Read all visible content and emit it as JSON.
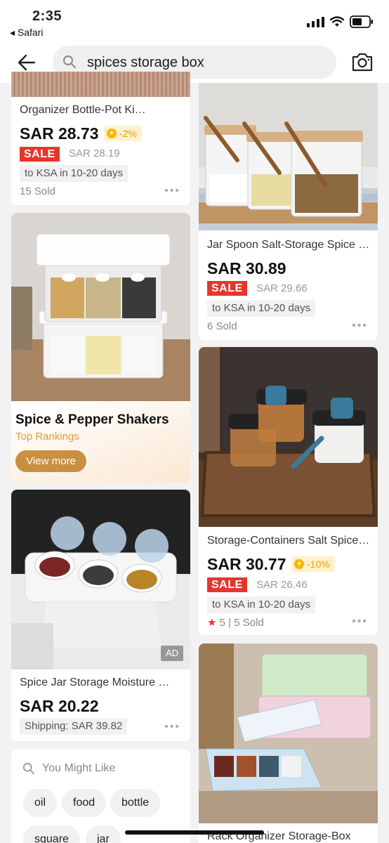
{
  "status_bar": {
    "time": "2:35",
    "back_app": "◂ Safari"
  },
  "search": {
    "query": "spices storage box"
  },
  "left_column": {
    "card1": {
      "title": "Organizer Bottle-Pot Kitchen",
      "price": "SAR 28.73",
      "discount": "-2%",
      "sale_label": "SALE",
      "old_price": "SAR 28.19",
      "shipping": "to KSA in 10-20 days",
      "sold": "15 Sold"
    },
    "promo": {
      "title": "Spice & Pepper Shakers",
      "subtitle": "Top Rankings",
      "button": "View more"
    },
    "card3": {
      "title": "Spice Jar Storage Moisture Proof",
      "price": "SAR 20.22",
      "shipping": "Shipping: SAR 39.82",
      "ad": "AD"
    },
    "might_like": {
      "title": "You Might Like",
      "chips": [
        "oil",
        "food",
        "bottle",
        "square",
        "jar"
      ]
    }
  },
  "right_column": {
    "card1": {
      "title": "Jar Spoon Salt-Storage Spice Box",
      "price": "SAR 30.89",
      "sale_label": "SALE",
      "old_price": "SAR 29.66",
      "shipping": "to KSA in 10-20 days",
      "sold": "6 Sold"
    },
    "card2": {
      "title": "Storage-Containers Salt Spice Jar",
      "price": "SAR 30.77",
      "discount": "-10%",
      "sale_label": "SALE",
      "old_price": "SAR 26.46",
      "shipping": "to KSA in 10-20 days",
      "rating": "5",
      "sold": "5 Sold"
    },
    "card3": {
      "title": "Rack Organizer Storage-Box"
    }
  },
  "dots": "•••",
  "colors": {
    "sale_red": "#e8352c",
    "discount_gold": "#f5b800",
    "promo_button": "#c99042"
  }
}
